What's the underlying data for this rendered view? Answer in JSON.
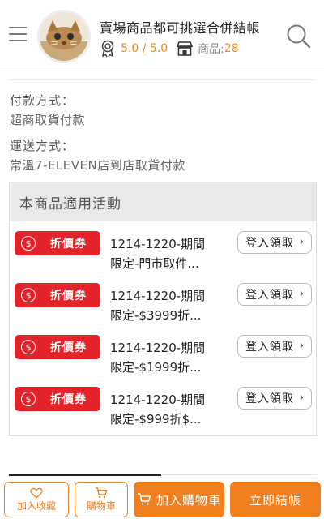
{
  "header": {
    "store_title": "賣場商品都可挑選合併結帳",
    "rating": "5.0 / 5.0",
    "products_label": "商品:",
    "products_count": "28"
  },
  "info": {
    "payment_label": "付款方式：",
    "payment_value": "超商取貨付款",
    "shipping_label": "運送方式：",
    "shipping_value": "常溫7-ELEVEN店到店取貨付款"
  },
  "promotions": {
    "header": "本商品適用活動",
    "items": [
      {
        "badge": "折價券",
        "line1": "1214-1220-期間",
        "line2": "限定-門市取件...",
        "action": "登入領取"
      },
      {
        "badge": "折價券",
        "line1": "1214-1220-期間",
        "line2": "限定-$3999折...",
        "action": "登入領取"
      },
      {
        "badge": "折價券",
        "line1": "1214-1220-期間",
        "line2": "限定-$1999折...",
        "action": "登入領取"
      },
      {
        "badge": "折價券",
        "line1": "1214-1220-期間",
        "line2": "限定-$999折$...",
        "action": "登入領取"
      }
    ]
  },
  "bottom_bar": {
    "favorite": "加入收藏",
    "cart": "購物車",
    "add_to_cart": "加入購物車",
    "checkout": "立即結帳"
  },
  "colors": {
    "accent_orange": "#f07f1f",
    "coupon_red": "#e4222a",
    "rating_orange": "#f28c18"
  }
}
